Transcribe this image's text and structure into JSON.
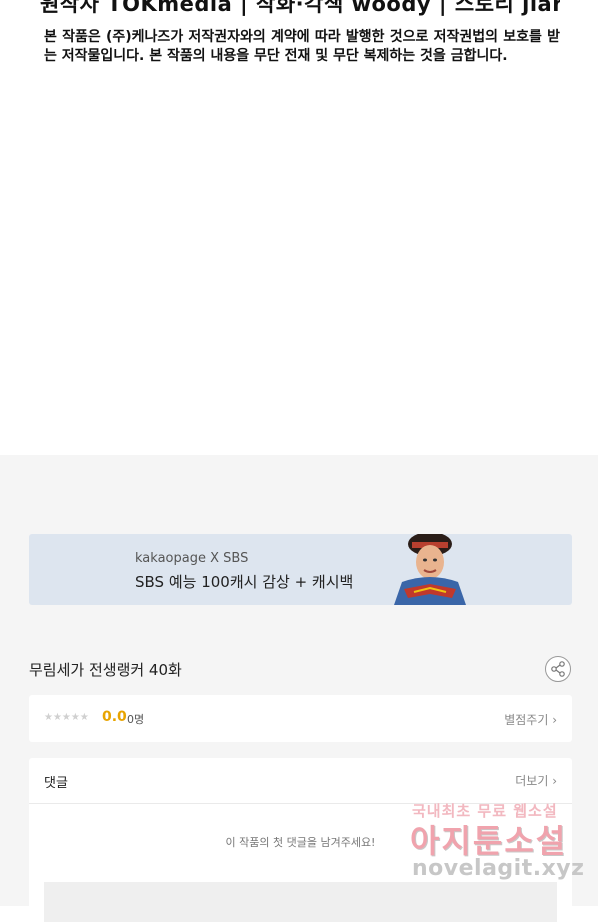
{
  "header": {
    "credits": "원작자 TOKmedia | 작화·각색 woody | 스토리 jianghwa",
    "notice": "본 작품은 (주)케나즈가 저작권자와의 계약에 따라 발행한 것으로 저작권법의 보호를 받는 저작물입니다. 본 작품의 내용을 무단 전재 및 무단 복제하는 것을 금합니다."
  },
  "banner": {
    "brand": "kakaopage X SBS",
    "text": "SBS 예능 100캐시 감상 + 캐시백"
  },
  "episode": {
    "title": "무림세가 전생랭커 40화"
  },
  "rating": {
    "stars": "★★★★★",
    "score": "0.0",
    "count": "0명",
    "rate_link": "별점주기 ›"
  },
  "comments": {
    "title": "댓글",
    "more_link": "더보기 ›",
    "empty_message": "이 작품의 첫 댓글을 남겨주세요!"
  },
  "watermark": {
    "top": "국내최초 무료 웹소설",
    "middle": "아지툰소설",
    "url": "novelagit.xyz"
  },
  "colors": {
    "accent_score": "#e8a400",
    "banner_bg": "#dde5ef",
    "page_bg": "#f5f5f5"
  }
}
